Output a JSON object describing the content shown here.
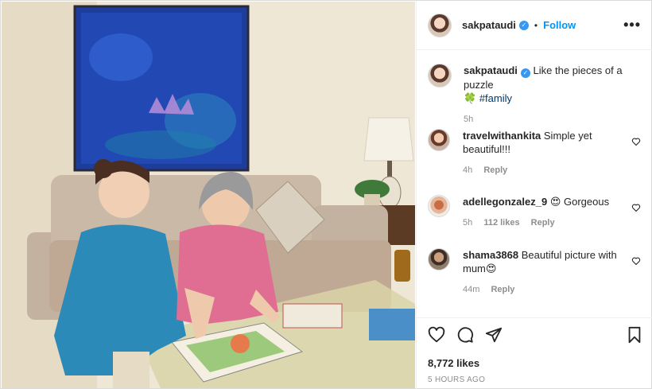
{
  "header": {
    "username": "sakpataudi",
    "separator": "•",
    "follow_label": "Follow",
    "more_label": "•••"
  },
  "caption": {
    "username": "sakpataudi",
    "text": "Like the pieces of a puzzle",
    "emoji": "🍀",
    "hashtag": "#family",
    "time": "5h"
  },
  "comments": [
    {
      "username": "travelwithankita",
      "text": "Simple yet beautiful!!!",
      "time": "4h",
      "likes": "",
      "reply": "Reply"
    },
    {
      "username": "adellegonzalez_9",
      "text": "😍 Gorgeous",
      "time": "5h",
      "likes": "112 likes",
      "reply": "Reply"
    },
    {
      "username": "shama3868",
      "text": "Beautiful picture with mum😍",
      "time": "44m",
      "likes": "",
      "reply": "Reply"
    }
  ],
  "footer": {
    "likes": "8,772 likes",
    "posted": "5 HOURS AGO"
  },
  "icons": {
    "like": "heart-icon",
    "comment": "comment-icon",
    "share": "send-icon",
    "save": "bookmark-icon"
  },
  "colors": {
    "link": "#0095f6",
    "hashtag": "#00376b",
    "verified": "#3897f0",
    "meta": "#8e8e8e"
  }
}
